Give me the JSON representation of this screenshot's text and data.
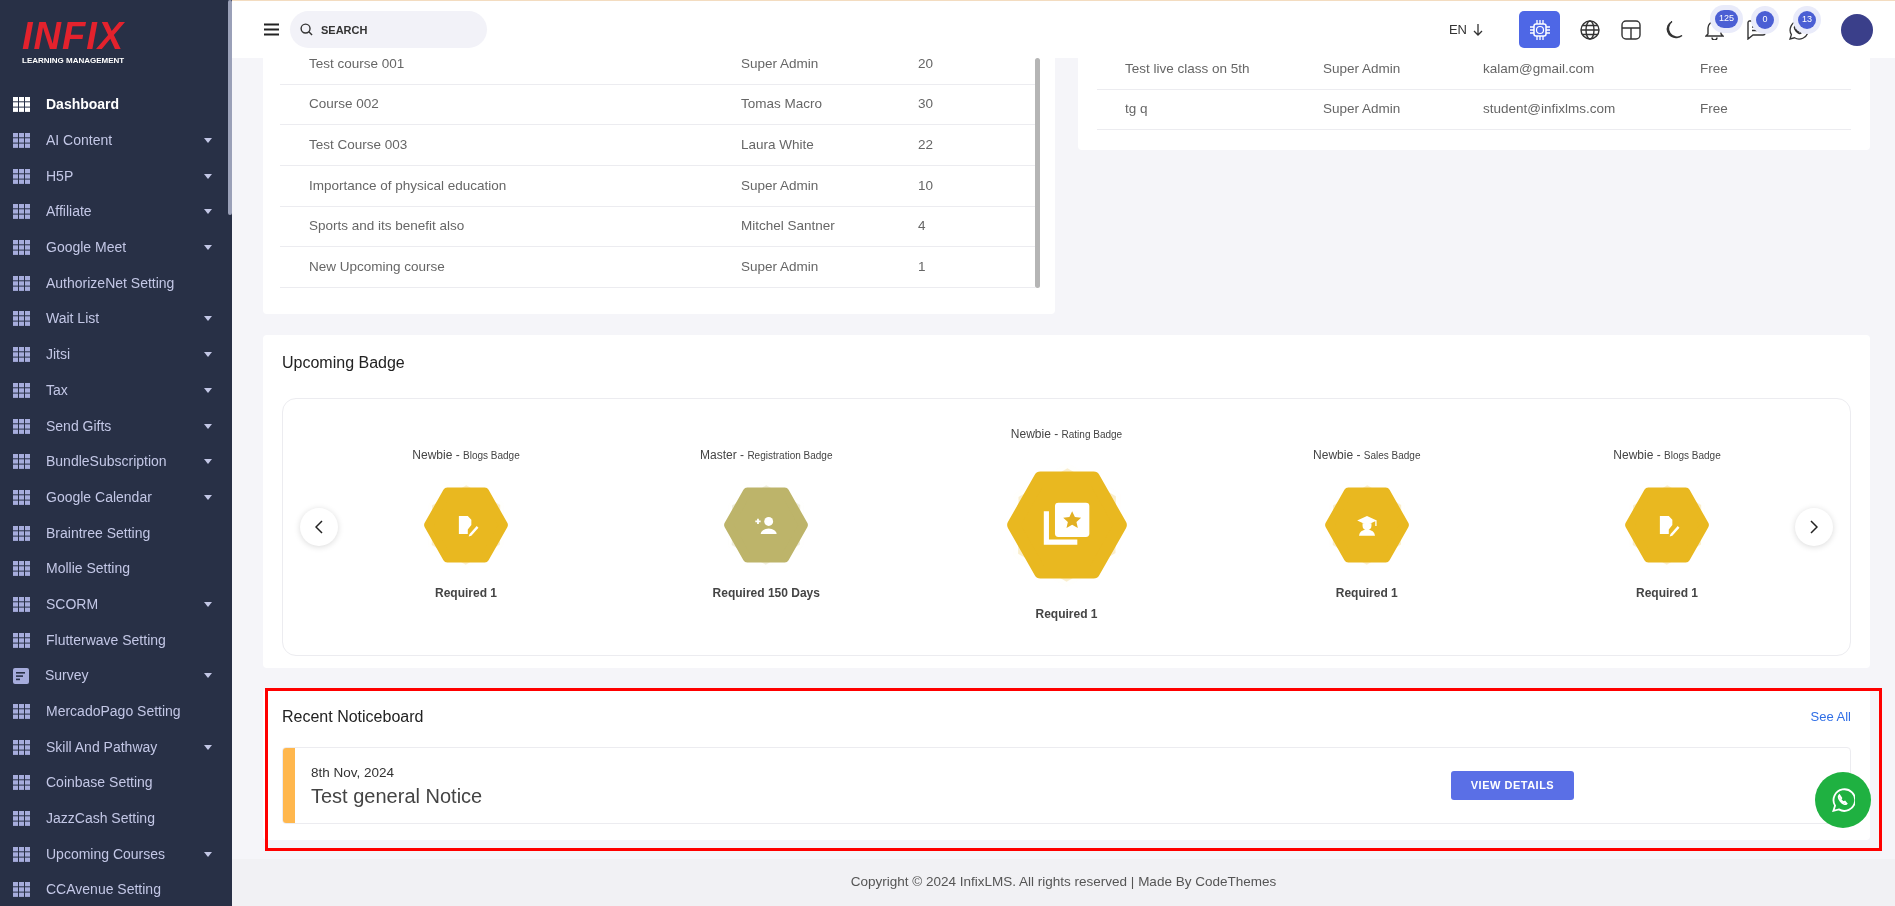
{
  "logo": {
    "mark": "INFIX",
    "tagline": "LEARNING MANAGEMENT"
  },
  "sidebar": {
    "items": [
      {
        "label": "Dashboard",
        "kind": "grid",
        "expandable": false,
        "selected": true
      },
      {
        "label": "AI Content",
        "kind": "grid",
        "expandable": true,
        "selected": false
      },
      {
        "label": "H5P",
        "kind": "grid",
        "expandable": true,
        "selected": false
      },
      {
        "label": "Affiliate",
        "kind": "grid",
        "expandable": true,
        "selected": false
      },
      {
        "label": "Google Meet",
        "kind": "grid",
        "expandable": true,
        "selected": false
      },
      {
        "label": "AuthorizeNet Setting",
        "kind": "grid",
        "expandable": false,
        "selected": false
      },
      {
        "label": "Wait List",
        "kind": "grid",
        "expandable": true,
        "selected": false
      },
      {
        "label": "Jitsi",
        "kind": "grid",
        "expandable": true,
        "selected": false
      },
      {
        "label": "Tax",
        "kind": "grid",
        "expandable": true,
        "selected": false
      },
      {
        "label": "Send Gifts",
        "kind": "grid",
        "expandable": true,
        "selected": false
      },
      {
        "label": "BundleSubscription",
        "kind": "grid",
        "expandable": true,
        "selected": false
      },
      {
        "label": "Google Calendar",
        "kind": "grid",
        "expandable": true,
        "selected": false
      },
      {
        "label": "Braintree Setting",
        "kind": "grid",
        "expandable": false,
        "selected": false
      },
      {
        "label": "Mollie Setting",
        "kind": "grid",
        "expandable": false,
        "selected": false
      },
      {
        "label": "SCORM",
        "kind": "grid",
        "expandable": true,
        "selected": false
      },
      {
        "label": "Flutterwave Setting",
        "kind": "grid",
        "expandable": false,
        "selected": false
      },
      {
        "label": "Survey",
        "kind": "form",
        "expandable": true,
        "selected": false
      },
      {
        "label": "MercadoPago Setting",
        "kind": "grid",
        "expandable": false,
        "selected": false
      },
      {
        "label": "Skill And Pathway",
        "kind": "grid",
        "expandable": true,
        "selected": false
      },
      {
        "label": "Coinbase Setting",
        "kind": "grid",
        "expandable": false,
        "selected": false
      },
      {
        "label": "JazzCash Setting",
        "kind": "grid",
        "expandable": false,
        "selected": false
      },
      {
        "label": "Upcoming Courses",
        "kind": "grid",
        "expandable": true,
        "selected": false
      },
      {
        "label": "CCAvenue Setting",
        "kind": "grid",
        "expandable": false,
        "selected": false
      }
    ]
  },
  "header": {
    "search": {
      "placeholder": "SEARCH"
    },
    "language": "EN",
    "notifications": "125",
    "messages": "0",
    "chats": "13"
  },
  "courses_table": {
    "rows": [
      [
        "Test course 001",
        "Super Admin",
        "20"
      ],
      [
        "Course 002",
        "Tomas Macro",
        "30"
      ],
      [
        "Test Course 003",
        "Laura White",
        "22"
      ],
      [
        "Importance of physical education",
        "Super Admin",
        "10"
      ],
      [
        "Sports and its benefit also",
        "Mitchel Santner",
        "4"
      ],
      [
        "New Upcoming course",
        "Super Admin",
        "1"
      ]
    ]
  },
  "classes_table": {
    "rows": [
      [
        "Test live class on 5th",
        "Super Admin",
        "kalam@gmail.com",
        "Free"
      ],
      [
        "tg q",
        "Super Admin",
        "student@infixlms.com",
        "Free"
      ]
    ]
  },
  "upcoming_badge": {
    "title": "Upcoming Badge",
    "badges": [
      {
        "title": "Newbie -",
        "subtitle": "Blogs Badge",
        "requirement": "Required 1",
        "kind": "blog",
        "large": false,
        "color": "#e9b820"
      },
      {
        "title": "Master -",
        "subtitle": "Registration Badge",
        "requirement": "Required 150 Days",
        "kind": "user-plus",
        "large": false,
        "color": "#bdb46a"
      },
      {
        "title": "Newbie -",
        "subtitle": "Rating Badge",
        "requirement": "Required 1",
        "kind": "rating",
        "large": true,
        "color": "#e9b820"
      },
      {
        "title": "Newbie -",
        "subtitle": "Sales Badge",
        "requirement": "Required 1",
        "kind": "graduate",
        "large": false,
        "color": "#e9b820"
      },
      {
        "title": "Newbie -",
        "subtitle": "Blogs Badge",
        "requirement": "Required 1",
        "kind": "blog",
        "large": false,
        "color": "#e9b820"
      }
    ]
  },
  "noticeboard": {
    "title": "Recent Noticeboard",
    "see_all": "See All",
    "highlighted": true,
    "notices": [
      {
        "date": "8th Nov, 2024",
        "title": "Test general Notice",
        "button": "VIEW DETAILS",
        "color": "#ffb74d"
      }
    ]
  },
  "footer": "Copyright © 2024 InfixLMS. All rights reserved | Made By CodeThemes"
}
